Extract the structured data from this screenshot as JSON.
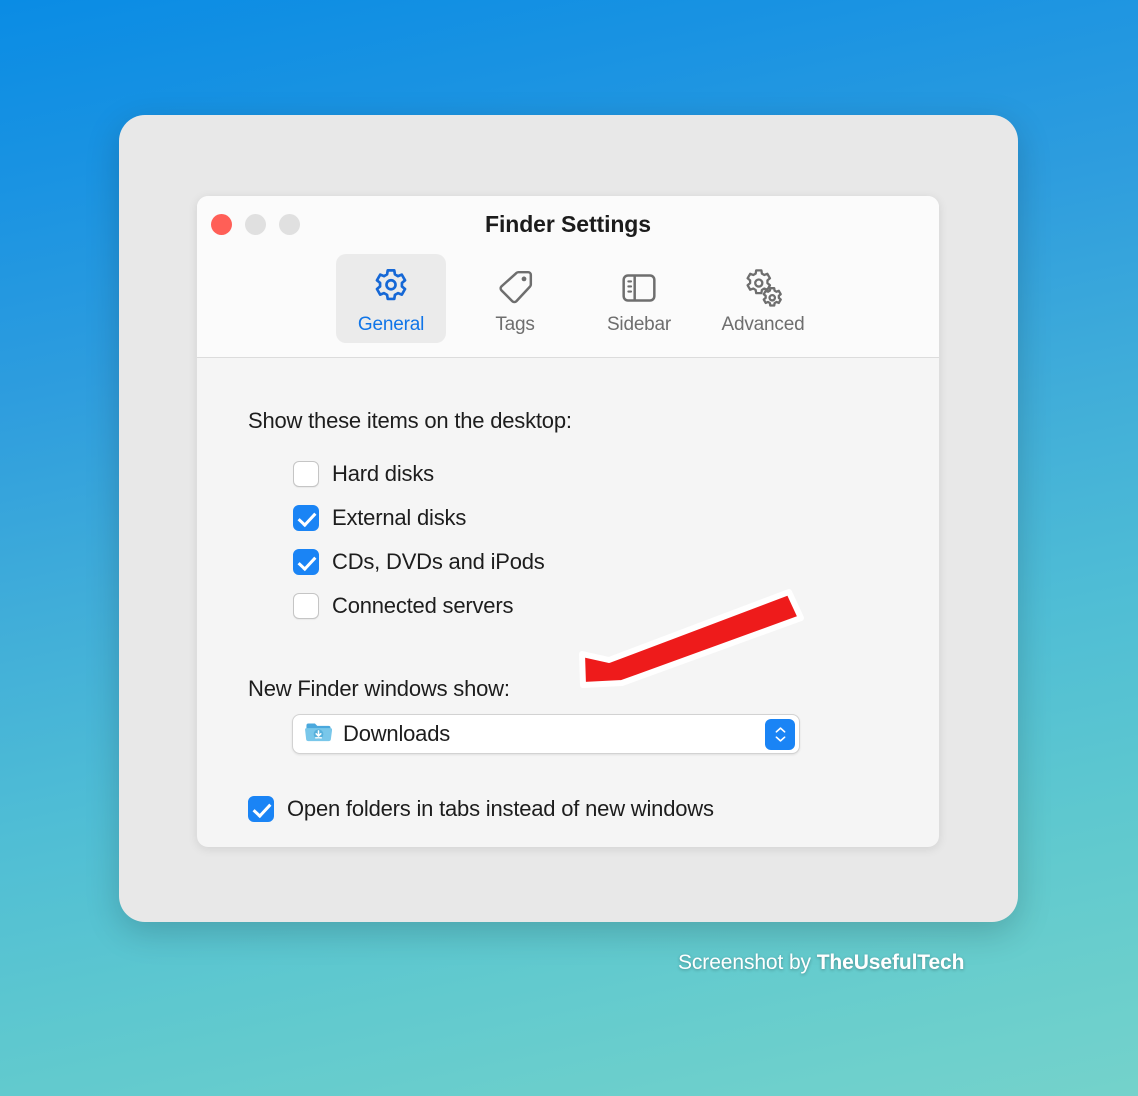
{
  "window": {
    "title": "Finder Settings",
    "traffic_lights": [
      {
        "name": "close",
        "color": "#ff5f57"
      },
      {
        "name": "minimize",
        "color": "#e0e0e0"
      },
      {
        "name": "zoom",
        "color": "#e0e0e0"
      }
    ]
  },
  "tabs": [
    {
      "label": "General",
      "icon": "gear-icon",
      "selected": true
    },
    {
      "label": "Tags",
      "icon": "tag-icon",
      "selected": false
    },
    {
      "label": "Sidebar",
      "icon": "sidebar-icon",
      "selected": false
    },
    {
      "label": "Advanced",
      "icon": "double-gear-icon",
      "selected": false
    }
  ],
  "general": {
    "desktop_items_label": "Show these items on the desktop:",
    "desktop_items": [
      {
        "label": "Hard disks",
        "checked": false
      },
      {
        "label": "External disks",
        "checked": true
      },
      {
        "label": "CDs, DVDs and iPods",
        "checked": true
      },
      {
        "label": "Connected servers",
        "checked": false
      }
    ],
    "new_window_label": "New Finder windows show:",
    "new_window_value": "Downloads",
    "new_window_icon": "downloads-folder-icon",
    "open_in_tabs": {
      "label": "Open folders in tabs instead of new windows",
      "checked": true
    }
  },
  "annotation": {
    "arrow": "red-arrow-pointing-left",
    "arrow_color": "#ee1b1b"
  },
  "watermark": {
    "prefix": "Screenshot by ",
    "brand": "TheUsefulTech"
  },
  "colors": {
    "accent": "#1a84f5",
    "tab_selected_text": "#1075e8",
    "background_top": "#0a8ce4",
    "background_bottom": "#74d2cb"
  }
}
